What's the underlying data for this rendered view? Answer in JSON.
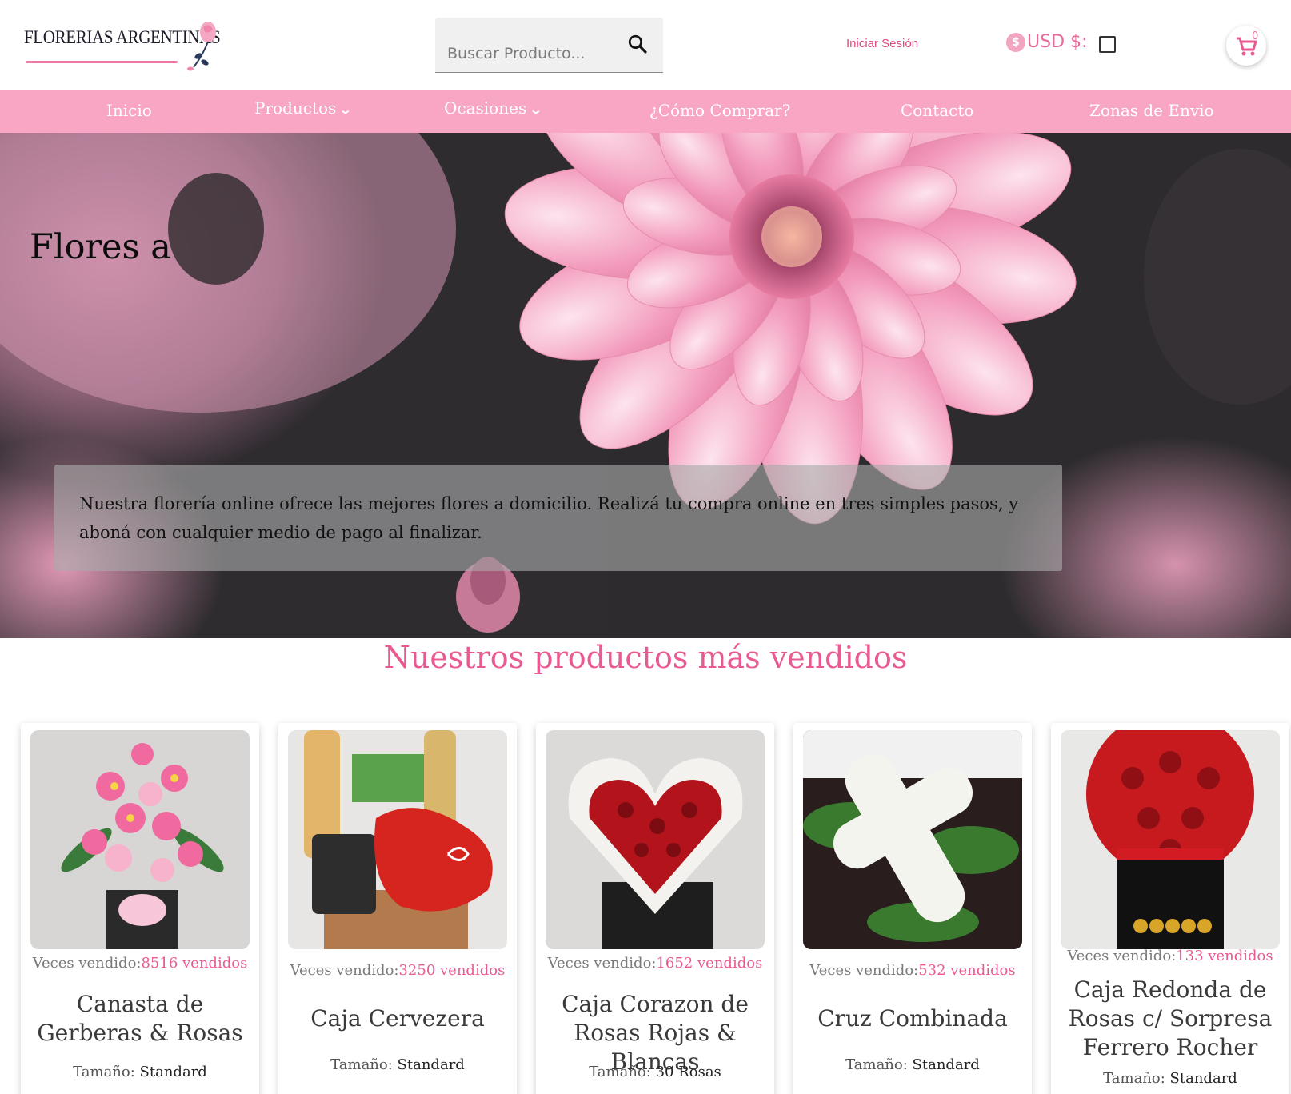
{
  "header": {
    "logo_text": "FLORERIAS ARGENTINAS",
    "search_placeholder": "Buscar Producto...",
    "login_label": "Iniciar Sesión",
    "currency_label": "USD $:",
    "cart_count": "0",
    "icons": [
      "search-icon",
      "currency-icon",
      "cart-icon"
    ]
  },
  "nav": {
    "items": [
      {
        "label": "Inicio"
      },
      {
        "label": "Productos",
        "dropdown": true
      },
      {
        "label": "Ocasiones",
        "dropdown": true
      },
      {
        "label": "¿Cómo Comprar?"
      },
      {
        "label": "Contacto"
      },
      {
        "label": "Zonas de Envio"
      }
    ]
  },
  "hero": {
    "title": "Flores a",
    "description": "Nuestra florería online ofrece las mejores flores a domicilio. Realizá tu compra online en tres simples pasos, y aboná con cualquier medio de pago al finalizar."
  },
  "section": {
    "title": "Nuestros productos más vendidos"
  },
  "products": [
    {
      "sold_label": "Veces vendido:",
      "sold_value": "8516 vendidos",
      "name": "Canasta de Gerberas & Rosas",
      "size_label": "Tamaño:",
      "size_value": "Standard"
    },
    {
      "sold_label": "Veces vendido:",
      "sold_value": "3250 vendidos",
      "name": "Caja Cervezera",
      "size_label": "Tamaño:",
      "size_value": "Standard"
    },
    {
      "sold_label": "Veces vendido:",
      "sold_value": "1652 vendidos",
      "name": "Caja Corazon de Rosas Rojas & Blancas",
      "size_label": "Tamaño:",
      "size_value": "30 Rosas"
    },
    {
      "sold_label": "Veces vendido:",
      "sold_value": "532 vendidos",
      "name": "Cruz Combinada",
      "size_label": "Tamaño:",
      "size_value": "Standard"
    },
    {
      "sold_label": "Veces vendido:",
      "sold_value": "133 vendidos",
      "name": "Caja Redonda de Rosas c/ Sorpresa Ferrero Rocher",
      "size_label": "Tamaño:",
      "size_value": "Standard"
    }
  ],
  "colors": {
    "accent": "#ea5a92",
    "nav_bg": "#f8a6c4",
    "login": "#e0467f"
  }
}
